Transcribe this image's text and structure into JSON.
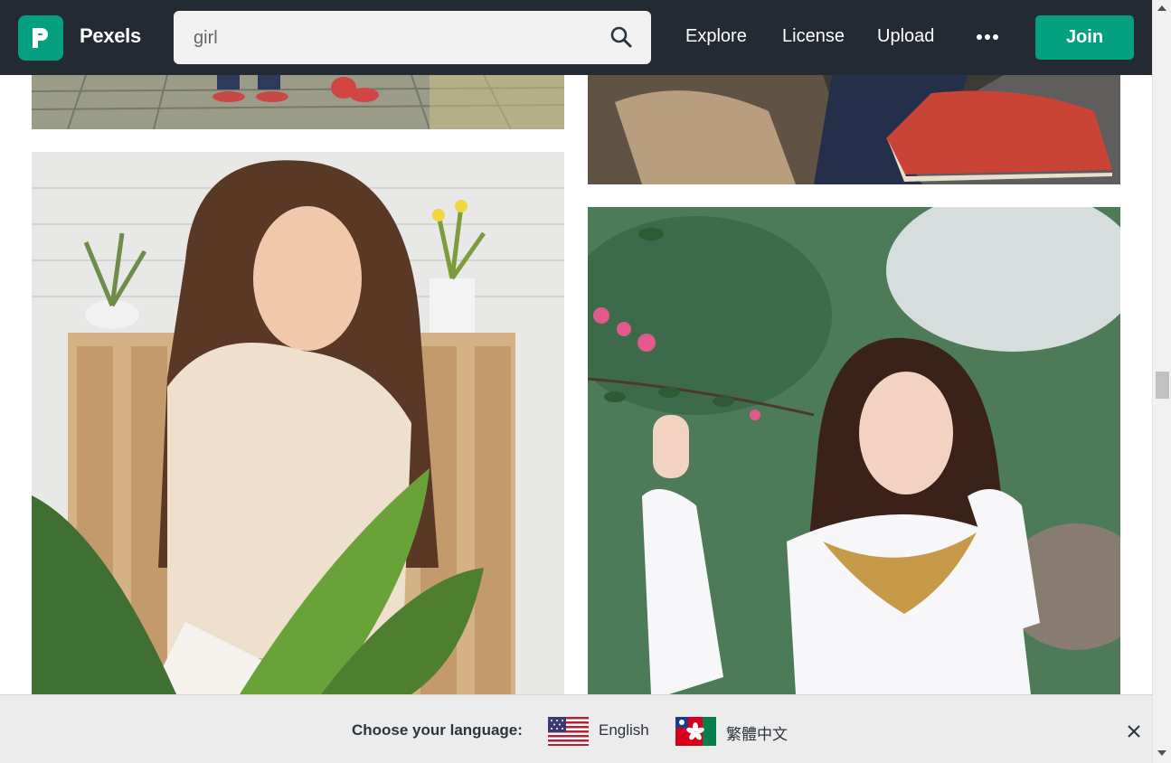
{
  "header": {
    "brand": "Pexels",
    "search": {
      "value": "girl",
      "placeholder": "Search for free photos"
    },
    "nav": [
      {
        "id": "explore",
        "label": "Explore"
      },
      {
        "id": "license",
        "label": "License"
      },
      {
        "id": "upload",
        "label": "Upload"
      }
    ],
    "join_label": "Join"
  },
  "photos": [
    {
      "id": "street",
      "alt": ""
    },
    {
      "id": "book",
      "alt": ""
    },
    {
      "id": "woman-blouse",
      "alt": ""
    },
    {
      "id": "woman-dress",
      "alt": ""
    }
  ],
  "language_banner": {
    "label": "Choose your language:",
    "options": [
      {
        "id": "english",
        "label": "English"
      },
      {
        "id": "traditional-chinese",
        "label": "繁體中文"
      }
    ]
  },
  "colors": {
    "header_bg": "#232a34",
    "brand_green": "#05a081",
    "banner_bg": "#ececec"
  },
  "icons": [
    "pexels-logo-icon",
    "search-icon",
    "more-icon",
    "us-flag-icon",
    "hk-flag-icon",
    "close-icon"
  ]
}
